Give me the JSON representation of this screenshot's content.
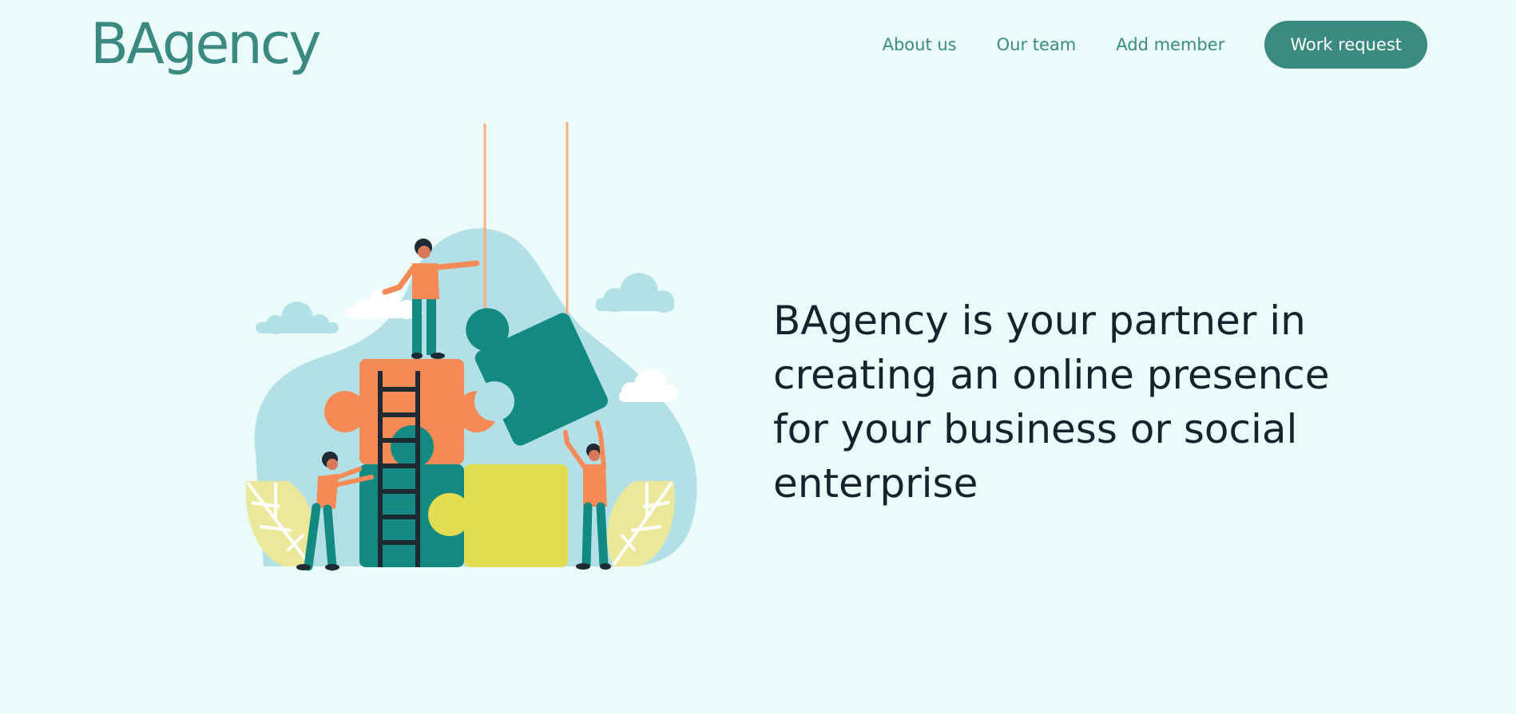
{
  "brand": {
    "name": "BAgency"
  },
  "nav": {
    "links": [
      {
        "label": "About us"
      },
      {
        "label": "Our team"
      },
      {
        "label": "Add member"
      }
    ],
    "cta_label": "Work request"
  },
  "hero": {
    "headline": "BAgency is your partner in creating an online presence for your business or social enterprise",
    "illustration_icon": "team-puzzle-illustration"
  },
  "colors": {
    "background": "#ebfbf9",
    "brand_teal": "#3b8a82",
    "headline_text": "#16232e",
    "puzzle_teal": "#128a82",
    "puzzle_orange": "#f58a56",
    "puzzle_yellow": "#e1dc50",
    "blob_blue": "#b3e0e6"
  }
}
